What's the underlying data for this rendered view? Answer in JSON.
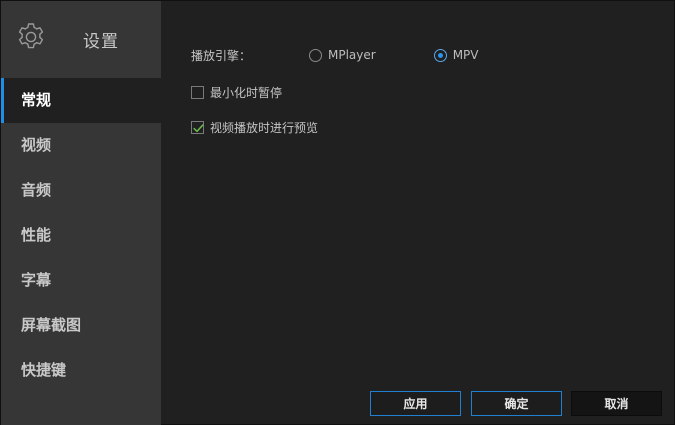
{
  "sidebar": {
    "title": "设置",
    "items": [
      {
        "label": "常规",
        "active": true
      },
      {
        "label": "视频"
      },
      {
        "label": "音频"
      },
      {
        "label": "性能"
      },
      {
        "label": "字幕"
      },
      {
        "label": "屏幕截图"
      },
      {
        "label": "快捷键"
      }
    ]
  },
  "general": {
    "engine_label": "播放引擎：",
    "engine_options": [
      "MPlayer",
      "MPV"
    ],
    "engine_selected": "MPV",
    "pause_on_minimize_label": "最小化时暂停",
    "pause_on_minimize_checked": false,
    "preview_label": "视频播放时进行预览",
    "preview_checked": true
  },
  "buttons": {
    "apply": "应用",
    "ok": "确定",
    "cancel": "取消"
  },
  "colors": {
    "accent": "#1e8fe6",
    "check": "#6cc04a"
  }
}
